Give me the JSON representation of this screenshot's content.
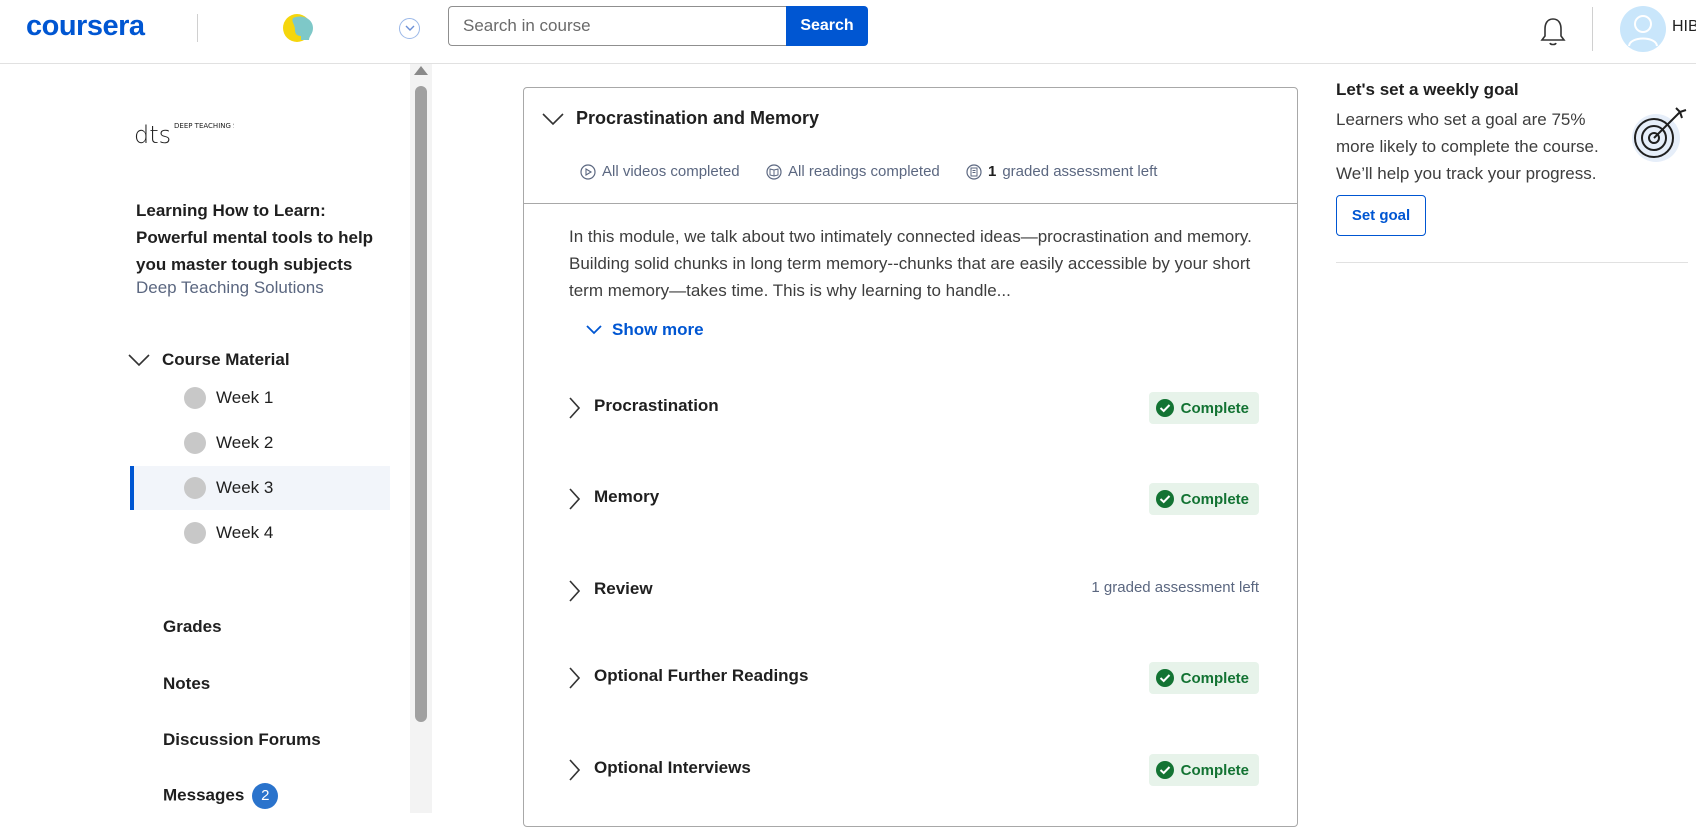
{
  "header": {
    "logo": "coursera",
    "search_placeholder": "Search in course",
    "search_button": "Search",
    "user_name": "HIBA"
  },
  "sidebar": {
    "partner_logo_text": "DEEP TEACHING SOLUTIONS",
    "course_title": "Learning How to Learn: Powerful mental tools to help you master tough subjects",
    "course_org": "Deep Teaching Solutions",
    "material_label": "Course Material",
    "weeks": [
      {
        "label": "Week 1",
        "active": false
      },
      {
        "label": "Week 2",
        "active": false
      },
      {
        "label": "Week 3",
        "active": true
      },
      {
        "label": "Week 4",
        "active": false
      }
    ],
    "links": {
      "grades": "Grades",
      "notes": "Notes",
      "forums": "Discussion Forums",
      "messages": "Messages",
      "messages_count": "2"
    }
  },
  "module": {
    "title": "Procrastination and Memory",
    "videos_status": "All videos completed",
    "readings_status": "All readings completed",
    "graded_count": "1",
    "graded_text": "graded assessment left",
    "description": "In this module, we talk about two intimately connected ideas—procrastination and memory. Building solid chunks in long term memory--chunks that are easily accessible by your short term memory—takes time. This is why learning to handle...",
    "show_more": "Show more",
    "lessons": [
      {
        "title": "Procrastination",
        "status": "Complete"
      },
      {
        "title": "Memory",
        "status": "Complete"
      },
      {
        "title": "Review",
        "status": "1 graded assessment left"
      },
      {
        "title": "Optional Further Readings",
        "status": "Complete"
      },
      {
        "title": "Optional Interviews",
        "status": "Complete"
      }
    ]
  },
  "goal": {
    "title": "Let's set a weekly goal",
    "text": "Learners who set a goal are 75% more likely to complete the course. We’ll help you track your progress.",
    "button": "Set goal"
  },
  "colors": {
    "brand": "#0056d2",
    "complete_bg": "#e7f3ea",
    "complete_text": "#137333"
  }
}
